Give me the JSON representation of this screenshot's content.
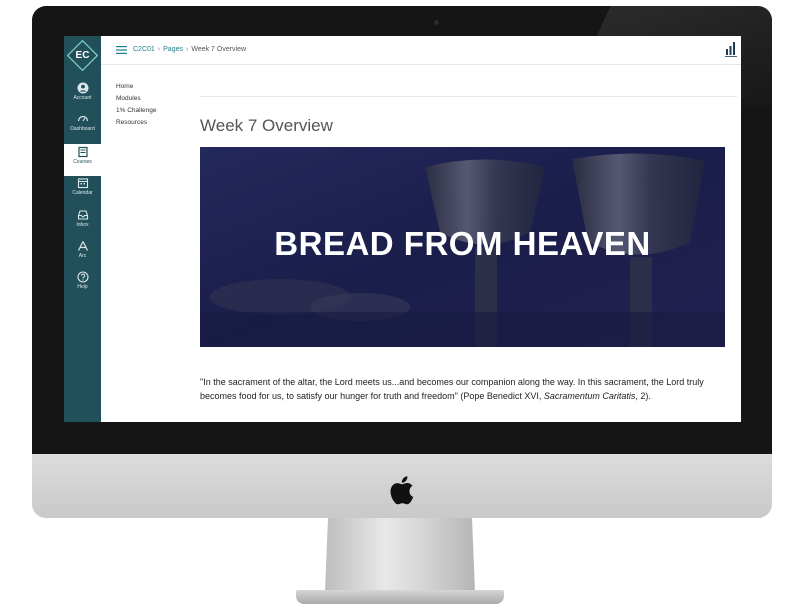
{
  "sidebar": {
    "logo": "EC",
    "items": [
      {
        "label": "Account",
        "icon": "account-icon",
        "active": false
      },
      {
        "label": "Dashboard",
        "icon": "dashboard-icon",
        "active": false
      },
      {
        "label": "Courses",
        "icon": "courses-icon",
        "active": true
      },
      {
        "label": "Calendar",
        "icon": "calendar-icon",
        "active": false
      },
      {
        "label": "Inbox",
        "icon": "inbox-icon",
        "active": false
      },
      {
        "label": "Arc",
        "icon": "arc-icon",
        "active": false
      },
      {
        "label": "Help",
        "icon": "help-icon",
        "active": false
      }
    ]
  },
  "breadcrumb": {
    "course": "C2C01",
    "section": "Pages",
    "current": "Week 7 Overview",
    "separator": "›"
  },
  "course_nav": [
    "Home",
    "Modules",
    "1% Challenge",
    "Resources"
  ],
  "page": {
    "title": "Week 7 Overview",
    "banner_text": "BREAD FROM HEAVEN",
    "quote_part1": "\"In the sacrament of the altar, the Lord meets us...and becomes our companion along the way. In this sacrament, the Lord truly becomes food for us, to satisfy our hunger for truth and freedom\" (Pope Benedict XVI, ",
    "quote_italic": "Sacramentum Caritatis",
    "quote_part2": ", 2)."
  },
  "colors": {
    "sidebar": "#21505b",
    "link": "#1f7f8a",
    "banner": "#1e2350"
  }
}
